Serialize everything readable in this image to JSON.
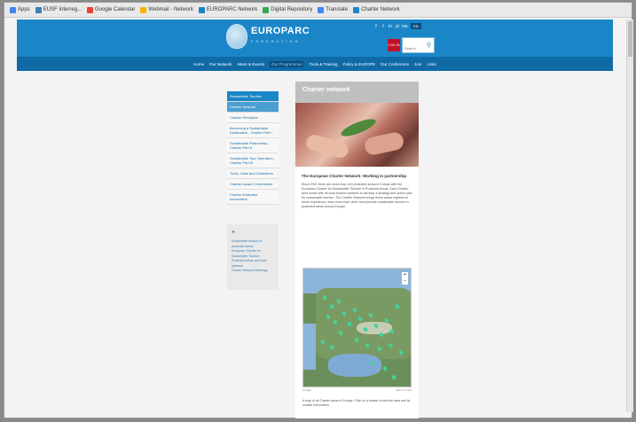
{
  "bookmarks": [
    {
      "label": "Apps",
      "color": "#4285f4"
    },
    {
      "label": "EUSF Interreg...",
      "color": "#3b7fb3"
    },
    {
      "label": "Google Calendar",
      "color": "#ea4335"
    },
    {
      "label": "Webmail - Network",
      "color": "#f4b400"
    },
    {
      "label": "EUROPARC Network",
      "color": "#1a86c8"
    },
    {
      "label": "Digital Repository",
      "color": "#34a853"
    },
    {
      "label": "Translate",
      "color": "#4285f4"
    },
    {
      "label": "Charter Network",
      "color": "#1a86c8"
    }
  ],
  "header": {
    "logo_text": "EUROPARC",
    "logo_sub": "FEDERATION",
    "social": [
      "f",
      "t",
      "in",
      "yt",
      "rss"
    ],
    "language": "EN",
    "login_label": "LOG IN",
    "search_placeholder": "Search"
  },
  "nav": {
    "items": [
      {
        "label": "Home",
        "active": false
      },
      {
        "label": "Our Network",
        "active": false
      },
      {
        "label": "News & Events",
        "active": false
      },
      {
        "label": "Our Programmes",
        "active": true
      },
      {
        "label": "Tools & Training",
        "active": false
      },
      {
        "label": "Policy & EUROPE",
        "active": false
      },
      {
        "label": "Our Conference",
        "active": false
      },
      {
        "label": "Join",
        "active": false
      },
      {
        "label": "Links",
        "active": false
      }
    ]
  },
  "sidebar": {
    "items": [
      {
        "label": "Sustainable Tourism",
        "kind": "head"
      },
      {
        "label": "Charter Network",
        "kind": "sel"
      },
      {
        "label": "Charter Principles",
        "kind": "normal"
      },
      {
        "label": "Becoming a Sustainable Destination - Charter Part I",
        "kind": "tall"
      },
      {
        "label": "Sustainable Partnership - Charter Part II",
        "kind": "tall"
      },
      {
        "label": "Sustainable Tour Operators - Charter Part III",
        "kind": "tall"
      },
      {
        "label": "Tools, Links and Guidelines",
        "kind": "normal"
      },
      {
        "label": "Charter Award Ceremonies",
        "kind": "normal"
      },
      {
        "label": "Charter Evaluator Information",
        "kind": "normal"
      }
    ],
    "box_lines": [
      "Sustainable tourism in protected areas",
      "European Charter for Sustainable Tourism",
      "Protected Areas and their partners",
      "Charter Network Meetings"
    ]
  },
  "main": {
    "title": "Charter network",
    "intro_heading": "The European Charter Network: Working in partnership",
    "intro_text": "Since 2001 there are more than 140 protected areas in Europe with the European Charter for Sustainable Tourism in Protected Areas. Each Charter area works with its local tourism partners to develop a strategy and action plan for sustainable tourism. The Charter Network brings these areas together to share experience, learn from each other and promote sustainable tourism in protected areas across Europe.",
    "map_footer_left": "Google",
    "map_footer_right": "Terms of Use",
    "caption": "A map of all Charter areas in Europe. Click on a marker to find the area and its contact information."
  }
}
